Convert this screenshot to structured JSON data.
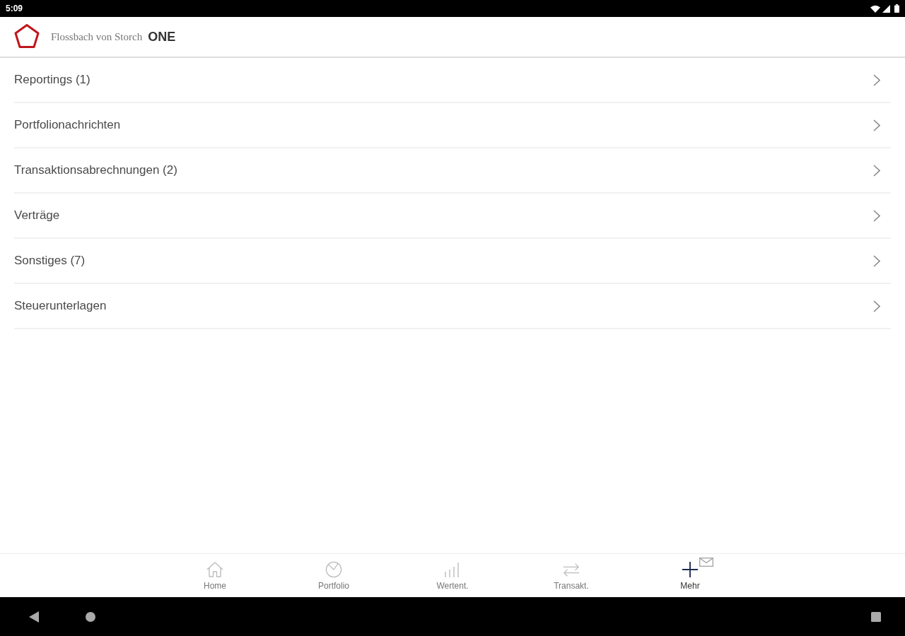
{
  "status_bar": {
    "time": "5:09"
  },
  "header": {
    "brand": "Flossbach von Storch",
    "product": "ONE"
  },
  "menu": {
    "items": [
      {
        "label": "Reportings (1)"
      },
      {
        "label": "Portfolionachrichten"
      },
      {
        "label": "Transaktionsabrechnungen (2)"
      },
      {
        "label": "Verträge"
      },
      {
        "label": "Sonstiges (7)"
      },
      {
        "label": "Steuerunterlagen"
      }
    ]
  },
  "bottom_nav": {
    "items": [
      {
        "kind": "home",
        "label": "Home",
        "selected": false
      },
      {
        "kind": "portfolio",
        "label": "Portfolio",
        "selected": false
      },
      {
        "kind": "chart",
        "label": "Wertent.",
        "selected": false
      },
      {
        "kind": "transfer",
        "label": "Transakt.",
        "selected": false
      },
      {
        "kind": "more",
        "label": "Mehr",
        "selected": true
      }
    ]
  }
}
